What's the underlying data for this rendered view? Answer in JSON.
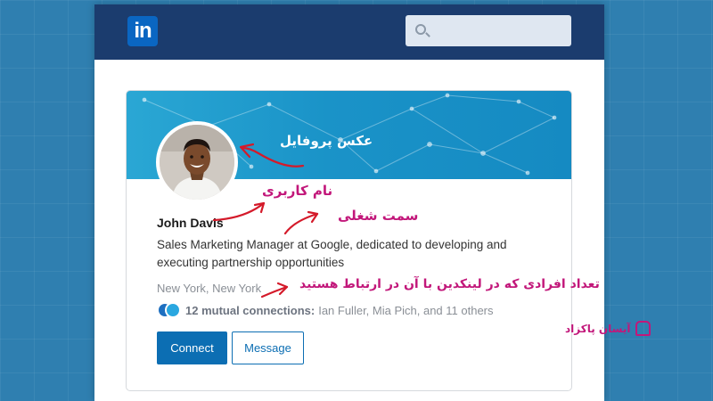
{
  "header": {
    "logo_text": "in",
    "search_placeholder": ""
  },
  "profile": {
    "name": "John Davis",
    "headline": "Sales Marketing Manager at Google, dedicated to developing and executing partnership opportunities",
    "location": "New York, New York",
    "mutual_count": "12 mutual connections:",
    "mutual_names": "Ian Fuller, Mia Pich, and 11 others",
    "connect_label": "Connect",
    "message_label": "Message"
  },
  "annotations": {
    "profile_picture": "عکس پروفایل",
    "username": "نام کاربری",
    "job_title": "سمت شغلی",
    "connections": "تعداد افرادی که در لینکدین با آن در ارتباط هستید"
  },
  "watermark": {
    "text": "آیسان پاکزاد"
  },
  "colors": {
    "header_bg": "#1b3c6e",
    "linkedin_blue": "#0a66c2",
    "annotation": "#c2177a",
    "page_bg": "#2f7fb0"
  }
}
